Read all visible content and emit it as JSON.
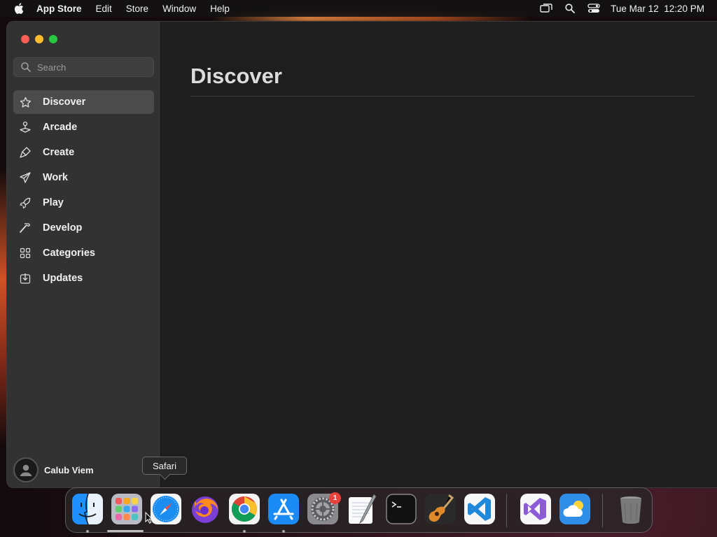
{
  "menubar": {
    "app_name": "App Store",
    "items": [
      "Edit",
      "Store",
      "Window",
      "Help"
    ],
    "datetime": "Tue Mar 12  12:20 PM"
  },
  "sidebar": {
    "search_placeholder": "Search",
    "items": [
      {
        "label": "Discover",
        "icon": "star-icon",
        "active": true
      },
      {
        "label": "Arcade",
        "icon": "joystick-icon",
        "active": false
      },
      {
        "label": "Create",
        "icon": "brush-icon",
        "active": false
      },
      {
        "label": "Work",
        "icon": "paper-plane-icon",
        "active": false
      },
      {
        "label": "Play",
        "icon": "rocket-icon",
        "active": false
      },
      {
        "label": "Develop",
        "icon": "hammer-icon",
        "active": false
      },
      {
        "label": "Categories",
        "icon": "grid-icon",
        "active": false
      },
      {
        "label": "Updates",
        "icon": "download-icon",
        "active": false
      }
    ],
    "user_name": "Calub Viem"
  },
  "main": {
    "title": "Discover"
  },
  "tooltip": "Safari",
  "dock": {
    "apps": [
      "Finder",
      "Launchpad",
      "Safari",
      "Firefox",
      "Chrome",
      "App Store",
      "System Settings",
      "TextEdit",
      "Terminal",
      "GarageBand",
      "VS Code",
      "Visual Studio",
      "Weather",
      "Trash"
    ],
    "settings_badge": "1"
  },
  "colors": {
    "close": "#fe5f57",
    "minimize": "#febc2e",
    "maximize": "#28c840",
    "sidebar": "#323232",
    "content": "#1e1e1e"
  }
}
